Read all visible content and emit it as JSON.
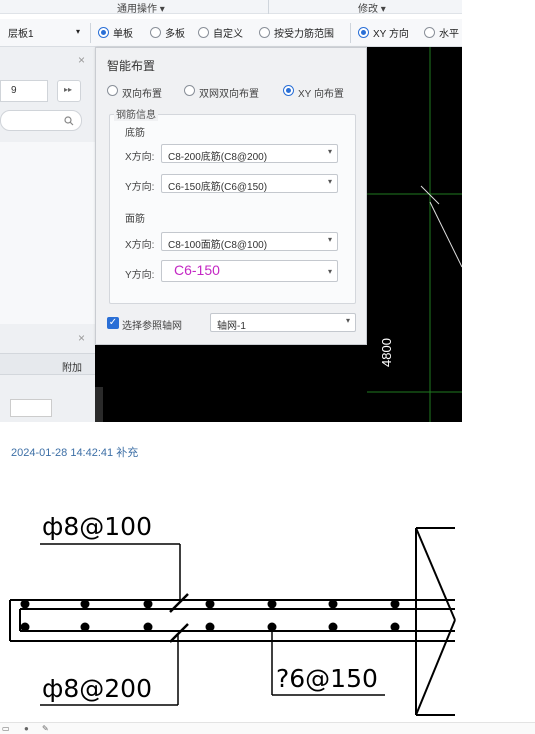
{
  "topbar": {
    "menu_general": "通用操作 ▾",
    "menu_modify": "修改 ▾"
  },
  "optbar": {
    "layer": "层板1",
    "single": "单板",
    "multi": "多板",
    "custom": "自定义",
    "by_range": "按受力筋范围",
    "xy_dir": "XY 方向",
    "horizontal": "水平"
  },
  "leftpanel": {
    "field_value": "9",
    "forward": "▸▸",
    "add": "附加",
    "close1": "×",
    "close2": "×"
  },
  "dialog": {
    "title": "智能布置",
    "opt_bidir": "双向布置",
    "opt_grid": "双网双向布置",
    "opt_xy": "XY 向布置",
    "rebar_info": "钢筋信息",
    "bottom_title": "底筋",
    "top_title": "面筋",
    "x_label": "X方向:",
    "y_label": "Y方向:",
    "bottom_x": "C8-200底筋(C8@200)",
    "bottom_y": "C6-150底筋(C6@150)",
    "top_x": "C8-100面筋(C8@100)",
    "top_y": "C6-150",
    "ref_axis_label": "选择参照轴网",
    "ref_axis_value": "轴网-1"
  },
  "canvas": {
    "dimension": "4800"
  },
  "stamp": "2024-01-28 14:42:41 补充",
  "drawing": {
    "top_label": "ф8@100",
    "bottom_left_label": "ф8@200",
    "bottom_right_label": "?6@150"
  }
}
